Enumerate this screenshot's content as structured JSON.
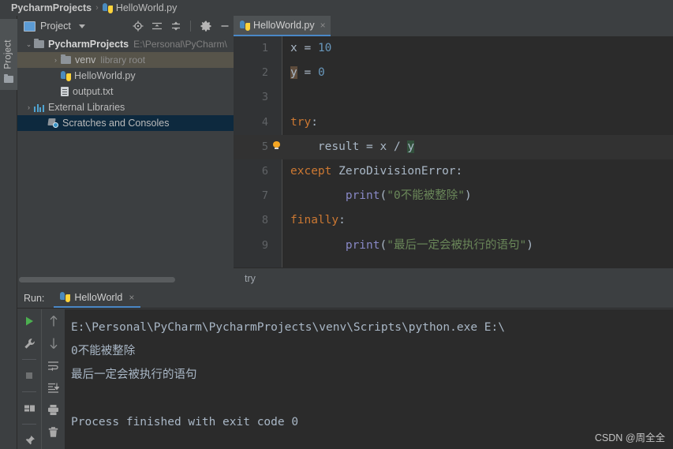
{
  "window": {
    "breadcrumb": {
      "project": "PycharmProjects",
      "separator": "›",
      "file": "HelloWorld.py"
    }
  },
  "left_strip": {
    "project_tab_label": "Project"
  },
  "project_panel": {
    "title": "Project",
    "tools": [
      {
        "name": "locate-icon",
        "tooltip": "Select Opened File"
      },
      {
        "name": "expand-all-icon",
        "tooltip": "Expand All"
      },
      {
        "name": "collapse-all-icon",
        "tooltip": "Collapse All"
      },
      {
        "name": "gear-icon",
        "tooltip": "Settings"
      },
      {
        "name": "minimize-icon",
        "tooltip": "Hide"
      }
    ],
    "tree": [
      {
        "label": "PycharmProjects",
        "path": "E:\\Personal\\PyCharm\\",
        "tag": "",
        "icon": "folder-icon",
        "arrow": "⌄",
        "expanded": true,
        "indent": 0,
        "state": "normal",
        "bold": true
      },
      {
        "label": "venv",
        "path": "",
        "tag": "library root",
        "icon": "folder-icon",
        "arrow": "›",
        "expanded": false,
        "indent": 1,
        "state": "hover",
        "bold": false
      },
      {
        "label": "HelloWorld.py",
        "path": "",
        "tag": "",
        "icon": "python-file-icon",
        "arrow": "",
        "expanded": false,
        "indent": 2,
        "state": "normal",
        "bold": false
      },
      {
        "label": "output.txt",
        "path": "",
        "tag": "",
        "icon": "text-file-icon",
        "arrow": "",
        "expanded": false,
        "indent": 2,
        "state": "normal",
        "bold": false
      },
      {
        "label": "External Libraries",
        "path": "",
        "tag": "",
        "icon": "library-icon",
        "arrow": "›",
        "expanded": false,
        "indent": 0,
        "state": "normal",
        "bold": false
      },
      {
        "label": "Scratches and Consoles",
        "path": "",
        "tag": "",
        "icon": "scratches-icon",
        "arrow": "",
        "expanded": false,
        "indent": 1,
        "state": "selected",
        "bold": false
      }
    ]
  },
  "editor": {
    "tab": {
      "label": "HelloWorld.py",
      "close": "×",
      "icon": "python-file-icon"
    },
    "breadcrumb_text": "try",
    "caret_line": 5,
    "lines": [
      {
        "no": "1",
        "bulb": false
      },
      {
        "no": "2",
        "bulb": false
      },
      {
        "no": "3",
        "bulb": false
      },
      {
        "no": "4",
        "bulb": false
      },
      {
        "no": "5",
        "bulb": true
      },
      {
        "no": "6",
        "bulb": false
      },
      {
        "no": "7",
        "bulb": false
      },
      {
        "no": "8",
        "bulb": false
      },
      {
        "no": "9",
        "bulb": false
      }
    ],
    "code": {
      "l1_var": "x",
      "l1_eq": " = ",
      "l1_num": "10",
      "l2_var": "y",
      "l2_eq": " = ",
      "l2_num": "0",
      "l4_kw": "try",
      "l4_colon": ":",
      "l5_indent": "    ",
      "l5_name": "result = x / ",
      "l5_hl": "y",
      "l6_kw": "except",
      "l6_cls": " ZeroDivisionError",
      "l6_colon": ":",
      "l7_indent": "        ",
      "l7_fn": "print",
      "l7_open": "(",
      "l7_str": "\"0不能被整除\"",
      "l7_close": ")",
      "l8_kw": "finally",
      "l8_colon": ":",
      "l9_indent": "        ",
      "l9_fn": "print",
      "l9_open": "(",
      "l9_str": "\"最后一定会被执行的语句\"",
      "l9_close": ")"
    }
  },
  "run_panel": {
    "label": "Run:",
    "tab_label": "HelloWorld",
    "tab_close": "×",
    "toolbar_left": [
      {
        "name": "run-icon",
        "tooltip": "Rerun"
      },
      {
        "name": "wrench-icon",
        "tooltip": "Edit Configuration"
      },
      {
        "name": "stop-icon",
        "tooltip": "Stop"
      },
      {
        "name": "layout-icon",
        "tooltip": "Restore Layout"
      },
      {
        "name": "pin-icon",
        "tooltip": "Pin Tab"
      }
    ],
    "toolbar_right": [
      {
        "name": "arrow-up-icon",
        "tooltip": "Up the Stack Trace"
      },
      {
        "name": "arrow-down-icon",
        "tooltip": "Down the Stack Trace"
      },
      {
        "name": "soft-wrap-icon",
        "tooltip": "Soft-Wrap"
      },
      {
        "name": "scroll-to-end-icon",
        "tooltip": "Scroll to End"
      },
      {
        "name": "print-icon",
        "tooltip": "Print"
      },
      {
        "name": "trash-icon",
        "tooltip": "Clear All"
      }
    ],
    "console": [
      "E:\\Personal\\PyCharm\\PycharmProjects\\venv\\Scripts\\python.exe E:\\",
      "0不能被整除",
      "最后一定会被执行的语句",
      "",
      "Process finished with exit code 0"
    ]
  },
  "watermark": "CSDN @周全全",
  "colors": {
    "panel_bg": "#3c3f41",
    "editor_bg": "#2b2b2b",
    "gutter_bg": "#313335",
    "accent_blue": "#4a88c7",
    "selection_navy": "#0d293e",
    "hover_brown": "#57544a",
    "keyword_orange": "#cc7832",
    "number_blue": "#6897bb",
    "string_green": "#6a8759",
    "function_violet": "#8888c6",
    "text_default": "#a9b7c6",
    "bulb_orange": "#f5a623"
  }
}
